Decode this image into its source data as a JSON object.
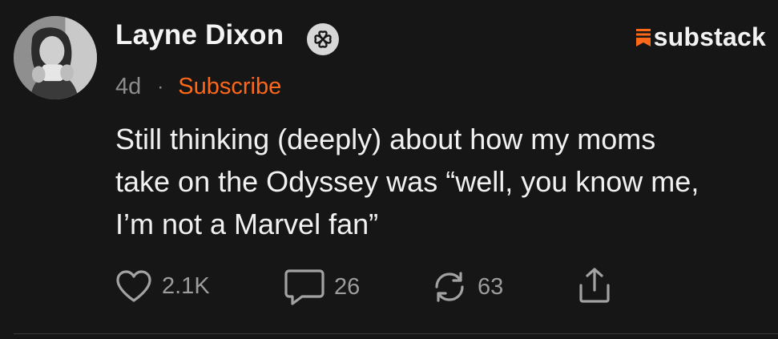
{
  "post": {
    "author": "Layne Dixon",
    "time": "4d",
    "separator": "·",
    "subscribe_label": "Subscribe",
    "body": "Still thinking (deeply) about how my moms\ntake on the Odyssey was “well, you know me,\nI’m not a Marvel fan”"
  },
  "brand": {
    "name": "substack",
    "accent": "#ff6719"
  },
  "actions": {
    "like": {
      "icon": "heart-icon",
      "count": "2.1K"
    },
    "comment": {
      "icon": "comment-icon",
      "count": "26"
    },
    "restack": {
      "icon": "restack-icon",
      "count": "63"
    },
    "share": {
      "icon": "share-icon"
    }
  },
  "colors": {
    "background": "#161616",
    "text": "#f1f1f1",
    "muted": "#8d8d8d"
  }
}
